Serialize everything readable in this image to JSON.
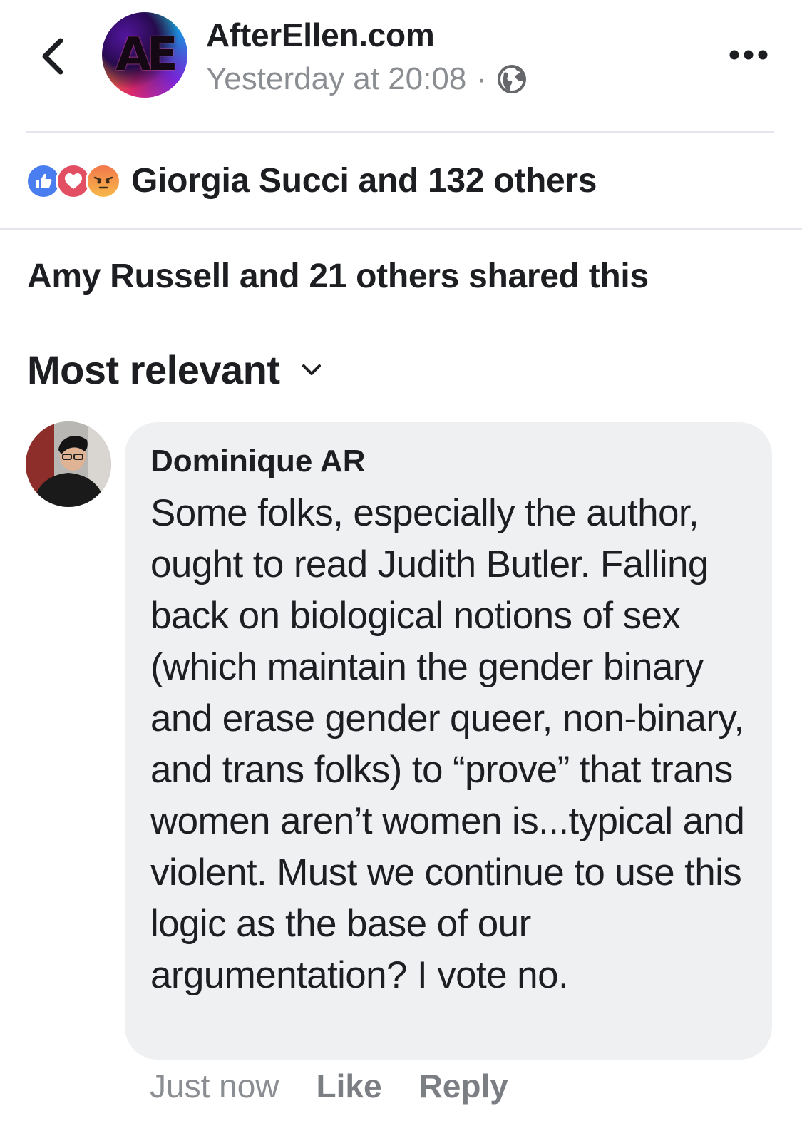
{
  "header": {
    "page_name": "AfterEllen.com",
    "avatar_logo": "AE",
    "timestamp": "Yesterday at 20:08",
    "separator": "·",
    "privacy_icon": "globe-icon",
    "back_icon": "chevron-left-icon",
    "more_icon": "more-dots-icon"
  },
  "reactions": {
    "icons": [
      "like-reaction-icon",
      "love-reaction-icon",
      "angry-reaction-icon"
    ],
    "summary": "Giorgia Succi and 132 others"
  },
  "shares": {
    "summary": "Amy Russell and 21 others shared this"
  },
  "sort": {
    "label": "Most relevant",
    "icon": "chevron-down-icon"
  },
  "comment": {
    "author": "Dominique AR",
    "text": "Some folks, especially the author, ought to read Judith Butler. Falling back on biological notions of sex (which maintain the gender binary and erase gender queer, non-binary, and trans folks) to “prove” that trans women aren’t women is...typical and violent. Must we continue to use this logic as the base of our argumentation? I vote no.",
    "time": "Just now",
    "like_label": "Like",
    "reply_label": "Reply"
  },
  "colors": {
    "like_blue": "#4a7ef0",
    "love_red": "#e24f62",
    "angry_orange": "#f2784b",
    "bubble_bg": "#eff0f2",
    "meta_gray": "#8a8d91"
  }
}
